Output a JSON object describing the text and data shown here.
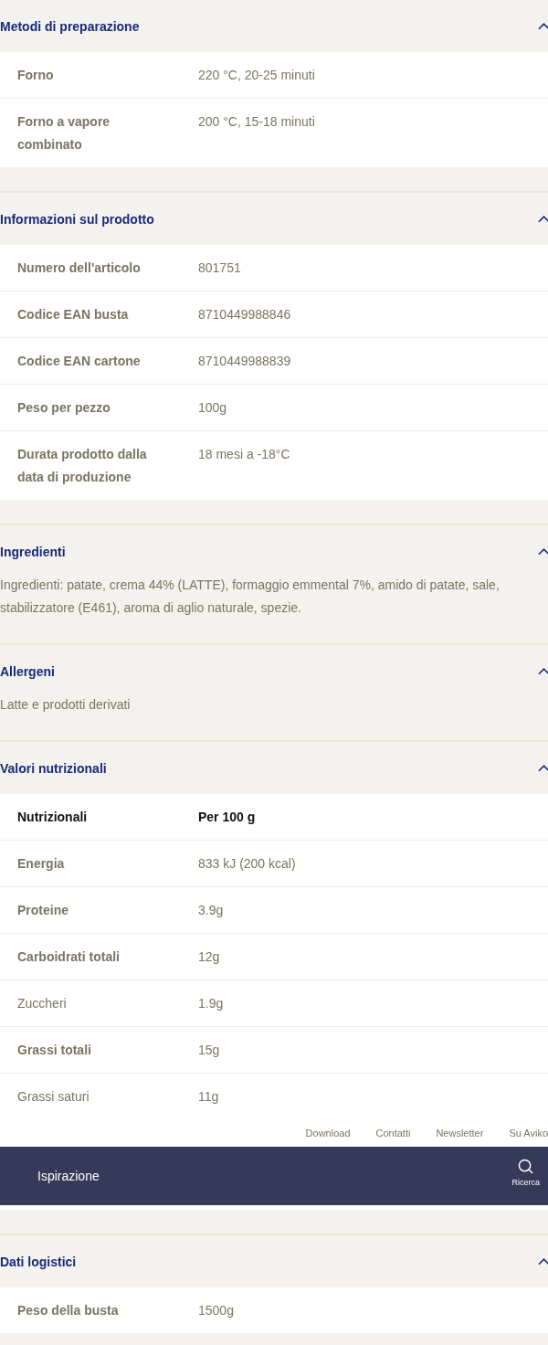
{
  "sections": [
    {
      "title": "Metodi di preparazione",
      "expanded": true,
      "kind": "table",
      "rows": [
        {
          "kind": "main",
          "label": "Forno",
          "value": "220 °C, 20-25 minuti"
        },
        {
          "kind": "main",
          "label": "Forno a vapore combinato",
          "value": "200 °C, 15-18 minuti"
        }
      ]
    },
    {
      "title": "Informazioni sul prodotto",
      "expanded": true,
      "kind": "table",
      "rows": [
        {
          "kind": "main",
          "label": "Numero dell'articolo",
          "value": "801751"
        },
        {
          "kind": "main",
          "label": "Codice EAN busta",
          "value": "8710449988846"
        },
        {
          "kind": "main",
          "label": "Codice EAN cartone",
          "value": "8710449988839"
        },
        {
          "kind": "main",
          "label": "Peso per pezzo",
          "value": "100g"
        },
        {
          "kind": "main",
          "label": "Durata prodotto dalla data di produzione",
          "value": "18 mesi a -18°C"
        }
      ]
    },
    {
      "title": "Ingredienti",
      "expanded": true,
      "kind": "text",
      "text": "Ingredienti: patate, crema 44% (LATTE), formaggio emmental 7%, amido di patate, sale, stabilizzatore (E461), aroma di aglio naturale, spezie."
    },
    {
      "title": "Allergeni",
      "expanded": true,
      "kind": "text",
      "text": "Latte e prodotti derivati"
    },
    {
      "title": "Valori nutrizionali",
      "expanded": true,
      "kind": "table",
      "rows": [
        {
          "kind": "head",
          "label": "Nutrizionali",
          "value": "Per 100 g"
        },
        {
          "kind": "main",
          "label": "Energia",
          "value": "833 kJ (200 kcal)"
        },
        {
          "kind": "main",
          "label": "Proteine",
          "value": "3.9g"
        },
        {
          "kind": "main",
          "label": "Carboidrati totali",
          "value": "12g"
        },
        {
          "kind": "sub",
          "label": "Zuccheri",
          "value": "1.9g"
        },
        {
          "kind": "main",
          "label": "Grassi totali",
          "value": "15g"
        },
        {
          "kind": "sub",
          "label": "Grassi saturi",
          "value": "11g"
        }
      ]
    }
  ],
  "footer_links": [
    "Download",
    "Contatti",
    "Newsletter",
    "Su Aviko"
  ],
  "bottom_bar": {
    "label": "Ispirazione",
    "search_label": "Ricerca"
  },
  "sections_below": [
    {
      "title": "Dati logistici",
      "expanded": true,
      "kind": "table",
      "rows": [
        {
          "kind": "main",
          "label": "Peso della busta",
          "value": "1500g"
        }
      ]
    }
  ]
}
